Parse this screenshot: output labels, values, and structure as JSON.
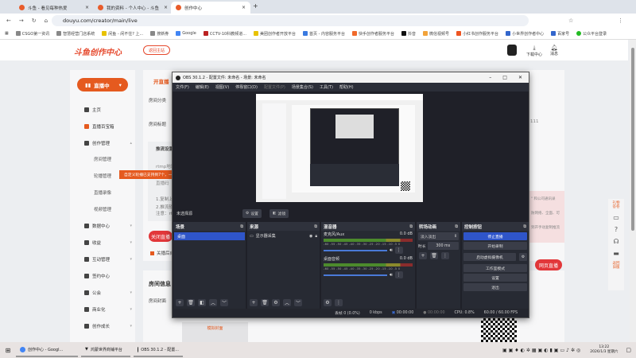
{
  "browser": {
    "tabs": [
      {
        "label": "斗鱼 - 看见每种热爱"
      },
      {
        "label": "我的资料 - 个人中心 - 斗鱼"
      },
      {
        "label": "创作中心"
      }
    ],
    "url": "douyu.com/creator/main/live",
    "bookmarks": [
      "CSGO第一资讯",
      "智慧经营门店系统",
      "闲鱼 - 闲不住? 上...",
      "搜新券",
      "Google",
      "CCTV-10科教频道...",
      "美团创作者开放平台",
      "首页 - 内容服务平台",
      "快手创作者服务平台",
      "抖音",
      "微信视频号",
      "小红书创作服务平台",
      "小世界创作者中心",
      "百家号",
      "公众平台登录"
    ]
  },
  "page": {
    "logo": "斗鱼创作中心",
    "back_home": "返回主站",
    "download": "下载中心",
    "messages": "消息",
    "live_button": "直播中",
    "nav": [
      {
        "label": "主页"
      },
      {
        "label": "直播百宝箱"
      },
      {
        "label": "创作管理"
      },
      {
        "label": "数据中心"
      },
      {
        "label": "收益"
      },
      {
        "label": "互动管理"
      },
      {
        "label": "签约中心"
      },
      {
        "label": "公会"
      },
      {
        "label": "商业化"
      },
      {
        "label": "创作成长"
      }
    ],
    "sub_nav": [
      "房间管理",
      "轮播管理",
      "直播录像",
      "视频管理"
    ],
    "tooltip": "自定义轮播已支持到7个，一",
    "section_title": "开直播",
    "room_category": "房间分类",
    "room_title": "房间标题",
    "title_value": "111",
    "stream_settings": "推流设置",
    "rtmp": "rtmp地址",
    "stream_code": "直播码",
    "notes": [
      "1.复制上",
      "2.推流软",
      "注意：rt"
    ],
    "pink_notes": [
      "\"  和公司通讯录",
      "防网络、全面、可",
      "到开手动复制推流"
    ],
    "close_live": "关闭直播",
    "checkbox_label": "关播后自",
    "web_live": "网页直播",
    "room_info": "房间信息",
    "room_cover": "房间封面",
    "cover_btn": "模拟封面",
    "float_bar": [
      "礼物答卷",
      "返回旧版"
    ]
  },
  "obs": {
    "title": "OBS 30.1.2 - 配置文件: 未命名 - 场景: 未命名",
    "menu": [
      "文件(F)",
      "编辑(E)",
      "视图(V)",
      "停靠窗口(D)",
      "配置文件(P)",
      "场景集合(S)",
      "工具(T)",
      "帮助(H)"
    ],
    "no_source": "未选择源",
    "settings_btn": "设置",
    "filters_btn": "滤镜",
    "scenes_title": "场景",
    "scenes": [
      "桌面"
    ],
    "sources_title": "来源",
    "sources": [
      "显示器采集"
    ],
    "mixer_title": "混音器",
    "mixer": [
      {
        "name": "麦克风/Aux",
        "db": "0.0 dB"
      },
      {
        "name": "桌面音频",
        "db": "0.0 dB"
      }
    ],
    "scale": "-60 -55 -50 -45 -40 -35 -30 -25 -20 -15 -10 -5 0",
    "transitions_title": "转场动画",
    "transition": "淡入淡出",
    "duration_label": "时长",
    "duration": "300 ms",
    "controls_title": "控制按钮",
    "controls": [
      "停止直播",
      "开始录制",
      "启动虚拟摄像机",
      "工作室模式",
      "设置",
      "退出"
    ],
    "status": {
      "dropped": "丢帧 0 (0.0%)",
      "kbps": "0 kbps",
      "live_time": "00:00:00",
      "rec_time": "00:00:00",
      "cpu": "CPU: 0.8%",
      "fps": "60.00 / 60.00 FPS"
    }
  },
  "taskbar": {
    "items": [
      "创作中心 - Googl...",
      "鸿蒙世界商铺平台",
      "OBS 30.1.2 - 配置..."
    ],
    "time": "13:22",
    "date": "2026/1/3 星期六"
  },
  "colors": {
    "accent": "#e55a1f",
    "obs_blue": "#2f55c9"
  }
}
